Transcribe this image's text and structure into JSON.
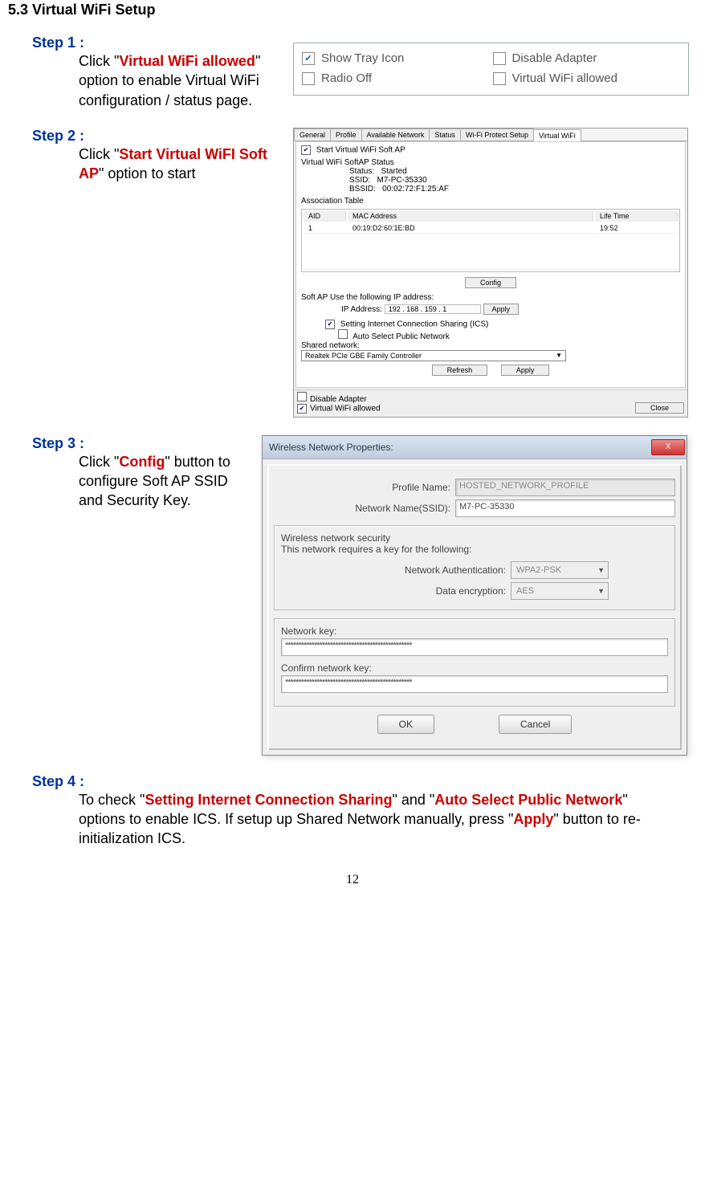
{
  "section_title": "5.3 Virtual WiFi Setup",
  "page_number": "12",
  "step1": {
    "label": "Step 1 :",
    "t1": "Click \"",
    "red": "Virtual WiFi allowed",
    "t2": "\" option to enable Virtual WiFi configuration / status page."
  },
  "step2": {
    "label": "Step 2 :",
    "t1": "Click \"",
    "red": "Start Virtual WiFI Soft AP",
    "t2": "\" option to start"
  },
  "step3": {
    "label": "Step 3 :",
    "t1": "Click \"",
    "red": "Config",
    "t2": "\" button to configure Soft AP SSID and Security Key."
  },
  "step4": {
    "label": "Step 4 :",
    "t1": "To check \"",
    "red1": "Setting Internet Connection Sharing",
    "t2": "\" and \"",
    "red2": "Auto Select Public Network",
    "t3": "\" options to enable ICS. If setup up Shared Network manually, press \"",
    "red3": "Apply",
    "t4": "\" button to re-initialization ICS."
  },
  "fig1": {
    "show_tray": "Show Tray Icon",
    "radio_off": "Radio Off",
    "disable_adapter": "Disable Adapter",
    "virtual_wifi": "Virtual WiFi allowed"
  },
  "fig2": {
    "tabs": [
      "General",
      "Profile",
      "Available Network",
      "Status",
      "Wi-Fi Protect Setup",
      "Virtual WiFi"
    ],
    "start_soft_ap": "Start Virtual WiFi Soft AP",
    "heading1": "Virtual WiFi SoftAP Status",
    "status_lbl": "Status:",
    "status_val": "Started",
    "ssid_lbl": "SSID:",
    "ssid_val": "M7-PC-35330",
    "bssid_lbl": "BSSID:",
    "bssid_val": "00:02:72:F1:25:AF",
    "assoc_heading": "Association Table",
    "cols": [
      "AID",
      "MAC Address",
      "Life Time"
    ],
    "row": [
      "1",
      "00:19:D2:60:1E:BD",
      "19:52"
    ],
    "config_btn": "Config",
    "ip_heading": "Soft AP Use the following IP address:",
    "ip_lbl": "IP Address:",
    "ip_val": "192 . 168 . 159 .   1",
    "apply_btn": "Apply",
    "ics_chk": "Setting Internet Connection Sharing (ICS)",
    "auto_chk": "Auto Select Public Network",
    "shared_lbl": "Shared network:",
    "shared_val": "Realtek PCIe GBE Family Controller",
    "refresh_btn": "Refresh",
    "disable_adapter": "Disable Adapter",
    "virtual_wifi": "Virtual WiFi allowed",
    "close_btn": "Close"
  },
  "fig3": {
    "title": "Wireless Network Properties:",
    "profile_lbl": "Profile Name:",
    "profile_val": "HOSTED_NETWORK_PROFILE",
    "ssid_lbl": "Network Name(SSID):",
    "ssid_val": "M7-PC-35330",
    "sec_heading": "Wireless network security",
    "sec_sub": "This network requires a key for the following:",
    "auth_lbl": "Network Authentication:",
    "auth_val": "WPA2-PSK",
    "enc_lbl": "Data encryption:",
    "enc_val": "AES",
    "key_lbl": "Network key:",
    "key_val": "************************************************",
    "confirm_lbl": "Confirm network key:",
    "confirm_val": "************************************************",
    "ok_btn": "OK",
    "cancel_btn": "Cancel",
    "close_x": "X"
  }
}
